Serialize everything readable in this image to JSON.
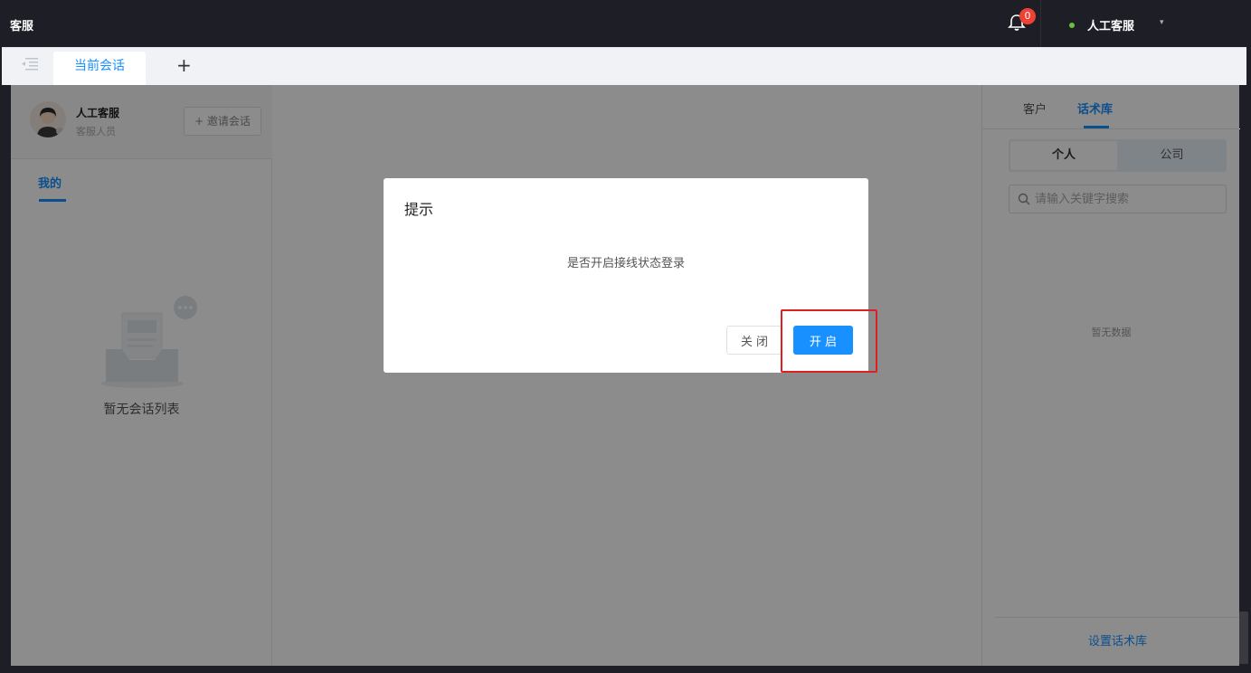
{
  "app": {
    "title": "客服"
  },
  "header": {
    "notification_count": "0",
    "user_status_color": "#67c23a",
    "user_name": "人工客服",
    "user_caret": "▾"
  },
  "tabs": {
    "current_label": "当前会话",
    "add_label": "+"
  },
  "left_panel": {
    "agent_name": "人工客服",
    "agent_role": "客服人员",
    "invite_label": "+ 邀请会话",
    "tab_mine": "我的",
    "empty_text": "暂无会话列表"
  },
  "right_panel": {
    "tab_customer": "客户",
    "tab_script": "话术库",
    "seg_personal": "个人",
    "seg_company": "公司",
    "search_placeholder": "请输入关键字搜索",
    "no_data": "暂无数据",
    "set_library": "设置话术库"
  },
  "dialog": {
    "title": "提示",
    "message": "是否开启接线状态登录",
    "close_label": "关 闭",
    "open_label": "开 启"
  },
  "colors": {
    "accent": "#1890ff",
    "topbar": "#1e1f26",
    "badge": "#f04134",
    "highlight": "#e02020"
  },
  "icons": [
    "bell-icon",
    "menu-toggle-icon",
    "avatar-icon",
    "chat-empty-icon",
    "search-icon"
  ]
}
